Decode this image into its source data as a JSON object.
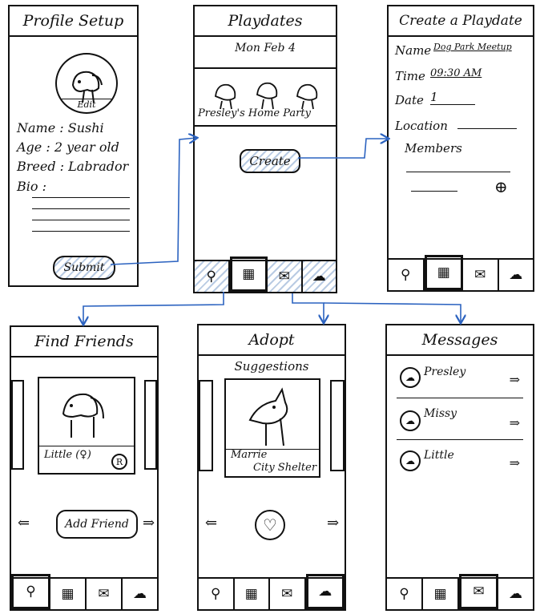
{
  "profile": {
    "title": "Profile Setup",
    "avatar_edit": "Edit",
    "name": "Name : Sushi",
    "age": "Age : 2 year old",
    "breed": "Breed : Labrador",
    "bio": "Bio :",
    "submit": "Submit"
  },
  "playdates": {
    "title": "Playdates",
    "date": "Mon Feb 4",
    "event": "Presley's Home Party",
    "create": "Create"
  },
  "create": {
    "title": "Create a Playdate",
    "name_label": "Name",
    "name_value": "Dog Park Meetup",
    "time_label": "Time",
    "time_value": "09:30 AM",
    "date_label": "Date",
    "date_value": "1",
    "location_label": "Location",
    "members_label": "Members",
    "add_icon": "⊕"
  },
  "find": {
    "title": "Find Friends",
    "card_name": "Little (♀)",
    "badge": "R",
    "add_friend": "Add Friend",
    "prev": "⇐",
    "next": "⇒"
  },
  "adopt": {
    "title": "Adopt",
    "subtitle": "Suggestions",
    "card_name": "Marrie",
    "card_shelter": "City Shelter",
    "prev": "⇐",
    "next": "⇒",
    "like": "♡"
  },
  "messages": {
    "title": "Messages",
    "items": [
      {
        "name": "Presley",
        "arrow": "⇒"
      },
      {
        "name": "Missy",
        "arrow": "⇒"
      },
      {
        "name": "Little",
        "arrow": "⇒"
      }
    ]
  },
  "nav": {
    "search": "⚲",
    "calendar": "▦",
    "mail": "✉",
    "chat": "☁"
  },
  "colors": {
    "arrow": "#2c63c0",
    "hatch": "#b9cbe3"
  }
}
